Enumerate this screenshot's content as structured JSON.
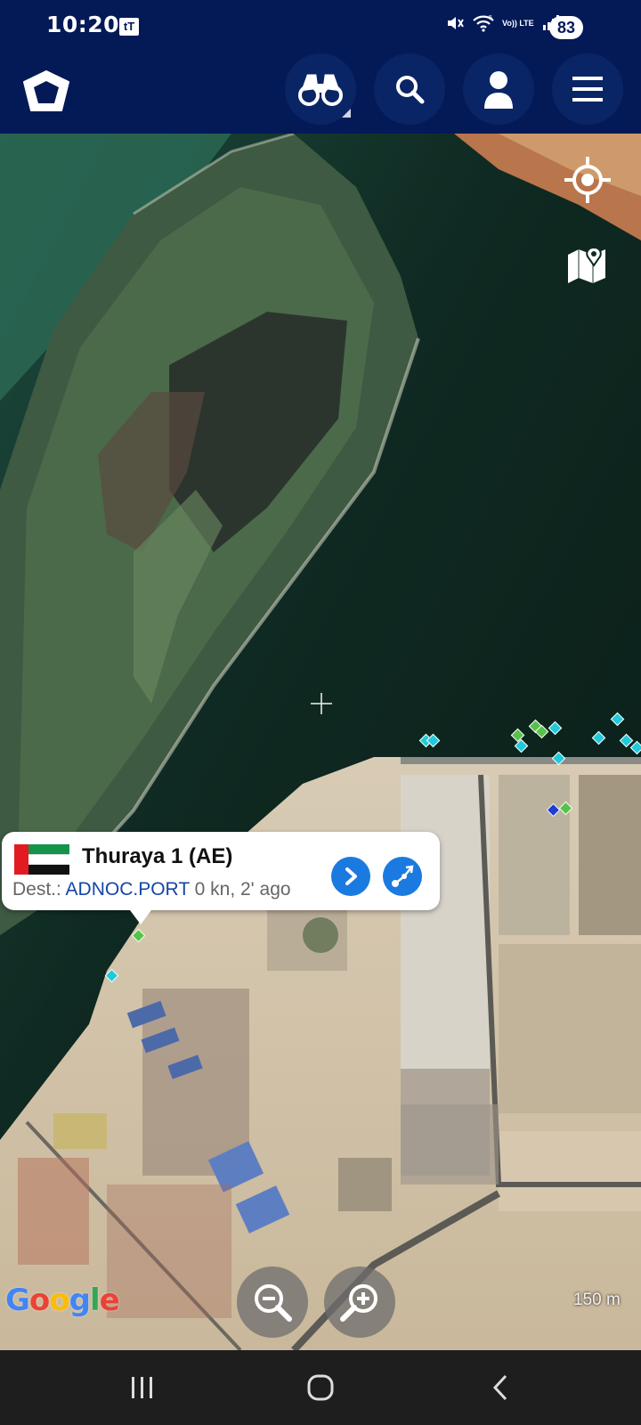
{
  "status_bar": {
    "time": "10:20",
    "tt_badge": "tT",
    "network": "5",
    "volte": "Vo)) LTE",
    "battery": "83"
  },
  "app_bar": {
    "logo": "pentagon-logo-icon",
    "buttons": [
      "binoculars-icon",
      "search-icon",
      "account-icon",
      "menu-icon"
    ],
    "colors": {
      "bar": "#041a57",
      "button": "#0a2566"
    }
  },
  "map": {
    "controls": [
      "my-location-icon",
      "map-layers-icon"
    ],
    "attribution": "Google",
    "scale_label": "150 m"
  },
  "popup": {
    "vessel_name": "Thuraya 1 (AE)",
    "dest_label": "Dest.:",
    "destination": "ADNOC.PORT",
    "speed_age": "0 kn, 2' ago",
    "flag": "UAE",
    "accent": "#1a7ae0"
  },
  "zoom": [
    "zoom-out-icon",
    "zoom-in-icon"
  ],
  "system_nav": [
    "recent-apps-icon",
    "home-icon",
    "back-icon"
  ]
}
